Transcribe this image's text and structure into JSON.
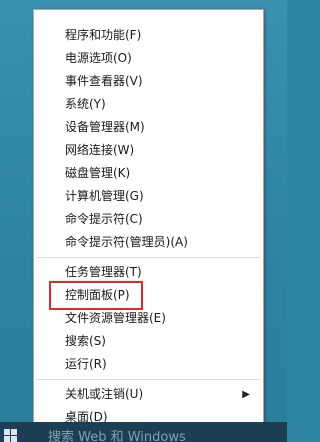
{
  "menu": {
    "items": [
      {
        "label": "程序和功能(F)"
      },
      {
        "label": "电源选项(O)"
      },
      {
        "label": "事件查看器(V)"
      },
      {
        "label": "系统(Y)"
      },
      {
        "label": "设备管理器(M)"
      },
      {
        "label": "网络连接(W)"
      },
      {
        "label": "磁盘管理(K)"
      },
      {
        "label": "计算机管理(G)"
      },
      {
        "label": "命令提示符(C)"
      },
      {
        "label": "命令提示符(管理员)(A)"
      },
      {
        "label": "任务管理器(T)"
      },
      {
        "label": "控制面板(P)",
        "highlighted": true
      },
      {
        "label": "文件资源管理器(E)"
      },
      {
        "label": "搜索(S)"
      },
      {
        "label": "运行(R)"
      },
      {
        "label": "关机或注销(U)",
        "has_submenu": true
      },
      {
        "label": "桌面(D)"
      }
    ],
    "submenu_arrow_icon": "chevron-right-icon",
    "highlight_color": "#e4292b"
  },
  "taskbar": {
    "search_hint": "搜索 Web 和 Windows",
    "start_icon": "windows-logo-icon"
  }
}
